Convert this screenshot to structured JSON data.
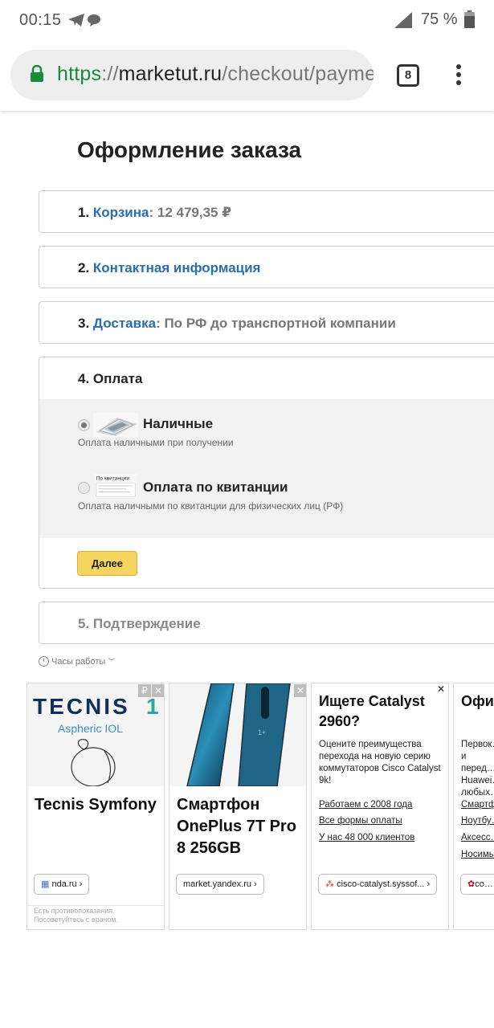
{
  "status": {
    "time": "00:15",
    "battery": "75 %"
  },
  "browser": {
    "url_scheme": "https",
    "url_sep": "://",
    "url_host": "marketut.ru",
    "url_path": "/checkout/payment",
    "tab_count": "8"
  },
  "page": {
    "title": "Оформление заказа",
    "steps": [
      {
        "num": "1.",
        "link": "Корзина",
        "colon": ":",
        "info": " 12 479,35 ₽"
      },
      {
        "num": "2.",
        "link": "Контактная информация"
      },
      {
        "num": "3.",
        "link": "Доставка",
        "colon": ":",
        "info": " По РФ до транспортной компании"
      },
      {
        "label": "4. Оплата"
      },
      {
        "label": "5. Подтверждение"
      }
    ],
    "payment": {
      "options": [
        {
          "title": "Наличные",
          "desc": "Оплата наличными при получении",
          "selected": true
        },
        {
          "title": "Оплата по квитанции",
          "desc": "Оплата наличными по квитанции для физических лиц (РФ)",
          "img_text": "По квитанции",
          "selected": false
        }
      ],
      "next_label": "Далее"
    },
    "hours_label": "Часы работы"
  },
  "ads": [
    {
      "brand": "TECNIS",
      "brand_suffix": "1",
      "brand_sub": "Aspheric IOL",
      "title": "Tecnis Symfony",
      "chip": "nda.ru ›",
      "disclaimer_1": "Есть противопоказания.",
      "disclaimer_2": "Посоветуйтесь с врачом.",
      "badge": "₽"
    },
    {
      "title": "Смартфон OnePlus 7T Pro 8 256GB",
      "chip": "market.yandex.ru ›"
    },
    {
      "heading": "Ищете Catalyst 2960?",
      "text": "Оцените преимущества перехода на новую серию коммутаторов Cisco Catalyst 9k!",
      "links": [
        "Работаем с 2008 года",
        "Все формы оплаты",
        "У нас 48 000 клиентов"
      ],
      "chip": "cisco-catalyst.syssof... ›"
    },
    {
      "heading": "Офи… мага…",
      "text": "Первок… и перед… Huawei… любых…",
      "links": [
        "Смартф…",
        "Ноутбу…",
        "Аксесс…",
        "Носимы…"
      ],
      "chip": "co…"
    }
  ]
}
